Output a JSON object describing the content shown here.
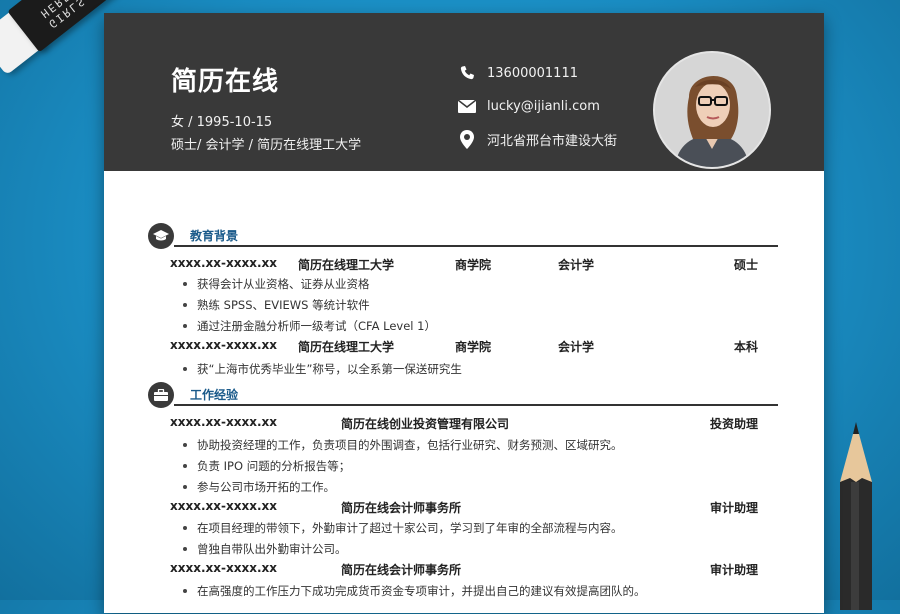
{
  "eraser": {
    "text": "GIRLS HERE"
  },
  "header": {
    "name": "简历在线",
    "gender_dob": "女 / 1995-10-15",
    "degree_line": "硕士/ 会计学 / 简历在线理工大学",
    "phone": "13600001111",
    "email": "lucky@ijianli.com",
    "address": "河北省邢台市建设大街"
  },
  "education": {
    "title": "教育背景",
    "entries": [
      {
        "date": "xxxx.xx-xxxx.xx",
        "school": "简历在线理工大学",
        "faculty": "商学院",
        "major": "会计学",
        "degree": "硕士",
        "bullets": [
          "获得会计从业资格、证券从业资格",
          "熟练 SPSS、EVIEWS 等统计软件",
          "通过注册金融分析师一级考试（CFA Level 1）"
        ]
      },
      {
        "date": "xxxx.xx-xxxx.xx",
        "school": "简历在线理工大学",
        "faculty": "商学院",
        "major": "会计学",
        "degree": "本科",
        "bullets": [
          "获“上海市优秀毕业生”称号，以全系第一保送研究生"
        ]
      }
    ]
  },
  "work": {
    "title": "工作经验",
    "entries": [
      {
        "date": "xxxx.xx-xxxx.xx",
        "company": "简历在线创业投资管理有限公司",
        "position": "投资助理",
        "bullets": [
          "协助投资经理的工作，负责项目的外围调查，包括行业研究、财务预测、区域研究。",
          "负责 IPO 问题的分析报告等；",
          "参与公司市场开拓的工作。"
        ]
      },
      {
        "date": "xxxx.xx-xxxx.xx",
        "company": "简历在线会计师事务所",
        "position": "审计助理",
        "bullets": [
          "在项目经理的带领下，外勤审计了超过十家公司，学习到了年审的全部流程与内容。",
          "曾独自带队出外勤审计公司。"
        ]
      },
      {
        "date": "xxxx.xx-xxxx.xx",
        "company": "简历在线会计师事务所",
        "position": "审计助理",
        "bullets": [
          "在高强度的工作压力下成功完成货币资金专项审计，并提出自己的建议有效提高团队的。"
        ]
      }
    ]
  }
}
